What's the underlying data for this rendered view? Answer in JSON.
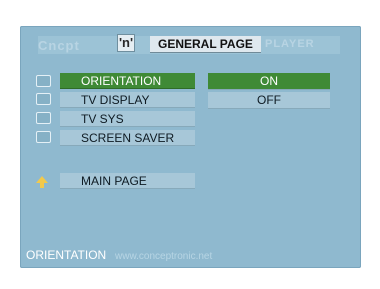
{
  "header": {
    "brand_left": "Cncpt",
    "brand_mark": "'n'",
    "title": "GENERAL PAGE",
    "brand_right": "PLAYER"
  },
  "menu": {
    "items": [
      {
        "label": "ORIENTATION",
        "icon": "orientation-icon",
        "selected": true
      },
      {
        "label": "TV DISPLAY",
        "icon": "tv-display-icon",
        "selected": false
      },
      {
        "label": "TV SYS",
        "icon": "tv-sys-icon",
        "selected": false
      },
      {
        "label": "SCREEN SAVER",
        "icon": "screen-saver-icon",
        "selected": false
      }
    ],
    "main_page": {
      "label": "MAIN PAGE",
      "icon": "arrow-up-icon"
    }
  },
  "options": [
    {
      "label": "ON",
      "selected": true
    },
    {
      "label": "OFF",
      "selected": false
    }
  ],
  "status": {
    "text": "ORIENTATION",
    "watermark": "www.conceptronic.net"
  },
  "colors": {
    "background": "#8fb9cf",
    "highlight": "#3f8a36",
    "item": "#a7c7d8"
  }
}
